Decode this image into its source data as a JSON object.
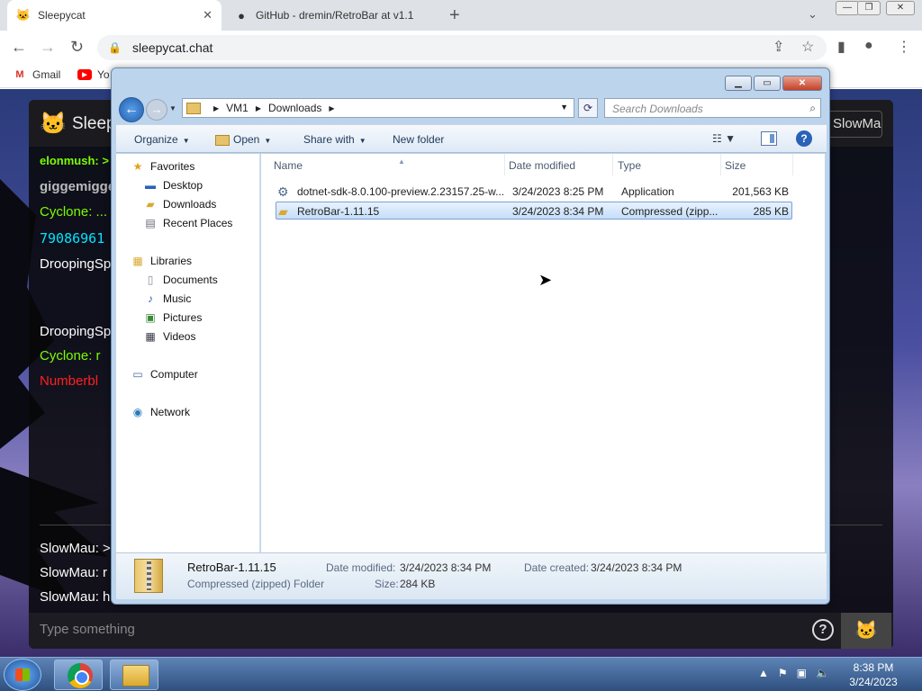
{
  "browser": {
    "tabs": [
      {
        "title": "Sleepycat",
        "active": true
      },
      {
        "title": "GitHub - dremin/RetroBar at v1.1",
        "active": false
      }
    ],
    "new_tab": "+",
    "url": "sleepycat.chat",
    "bookmarks": [
      {
        "label": "Gmail"
      },
      {
        "label": "Yo"
      }
    ]
  },
  "chat": {
    "title": "Sleep",
    "user_button": "SlowMau",
    "messages": [
      {
        "text": "elonmush: >",
        "color": "#7CFC00"
      },
      {
        "text": "giggemigge",
        "color": "#bbbbbb"
      },
      {
        "text": "Cyclone: ...",
        "color": "#7CFC00"
      },
      {
        "text": "79086961",
        "color": "#00e5ff"
      },
      {
        "text": "DroopingSp",
        "color": "#ffffff"
      },
      {
        "text": "DroopingSp",
        "color": "#ffffff"
      },
      {
        "text": "Cyclone: r",
        "color": "#7CFC00"
      },
      {
        "text": "Numberbl",
        "color": "#ff2020"
      },
      {
        "text": "SlowMau: >",
        "color": "#ffffff"
      },
      {
        "text": "SlowMau: r",
        "color": "#ffffff"
      },
      {
        "text": "SlowMau: h",
        "color": "#ffffff"
      }
    ],
    "input_placeholder": "Type something",
    "help_label": "?"
  },
  "explorer": {
    "breadcrumb": [
      "VM1",
      "Downloads"
    ],
    "search_placeholder": "Search Downloads",
    "commands": {
      "organize": "Organize",
      "open": "Open",
      "share_with": "Share with",
      "new_folder": "New folder"
    },
    "nav": {
      "favorites": "Favorites",
      "favorites_items": [
        "Desktop",
        "Downloads",
        "Recent Places"
      ],
      "libraries": "Libraries",
      "libraries_items": [
        "Documents",
        "Music",
        "Pictures",
        "Videos"
      ],
      "computer": "Computer",
      "network": "Network"
    },
    "columns": [
      "Name",
      "Date modified",
      "Type",
      "Size"
    ],
    "files": [
      {
        "name": "dotnet-sdk-8.0.100-preview.2.23157.25-w...",
        "date": "3/24/2023 8:25 PM",
        "type": "Application",
        "size": "201,563 KB",
        "selected": false
      },
      {
        "name": "RetroBar-1.11.15",
        "date": "3/24/2023 8:34 PM",
        "type": "Compressed (zipp...",
        "size": "285 KB",
        "selected": true
      }
    ],
    "details": {
      "name": "RetroBar-1.11.15",
      "kind": "Compressed (zipped) Folder",
      "date_modified_label": "Date modified:",
      "date_modified": "3/24/2023 8:34 PM",
      "size_label": "Size:",
      "size": "284 KB",
      "date_created_label": "Date created:",
      "date_created": "3/24/2023 8:34 PM"
    }
  },
  "taskbar": {
    "time": "8:38 PM",
    "date": "3/24/2023"
  }
}
